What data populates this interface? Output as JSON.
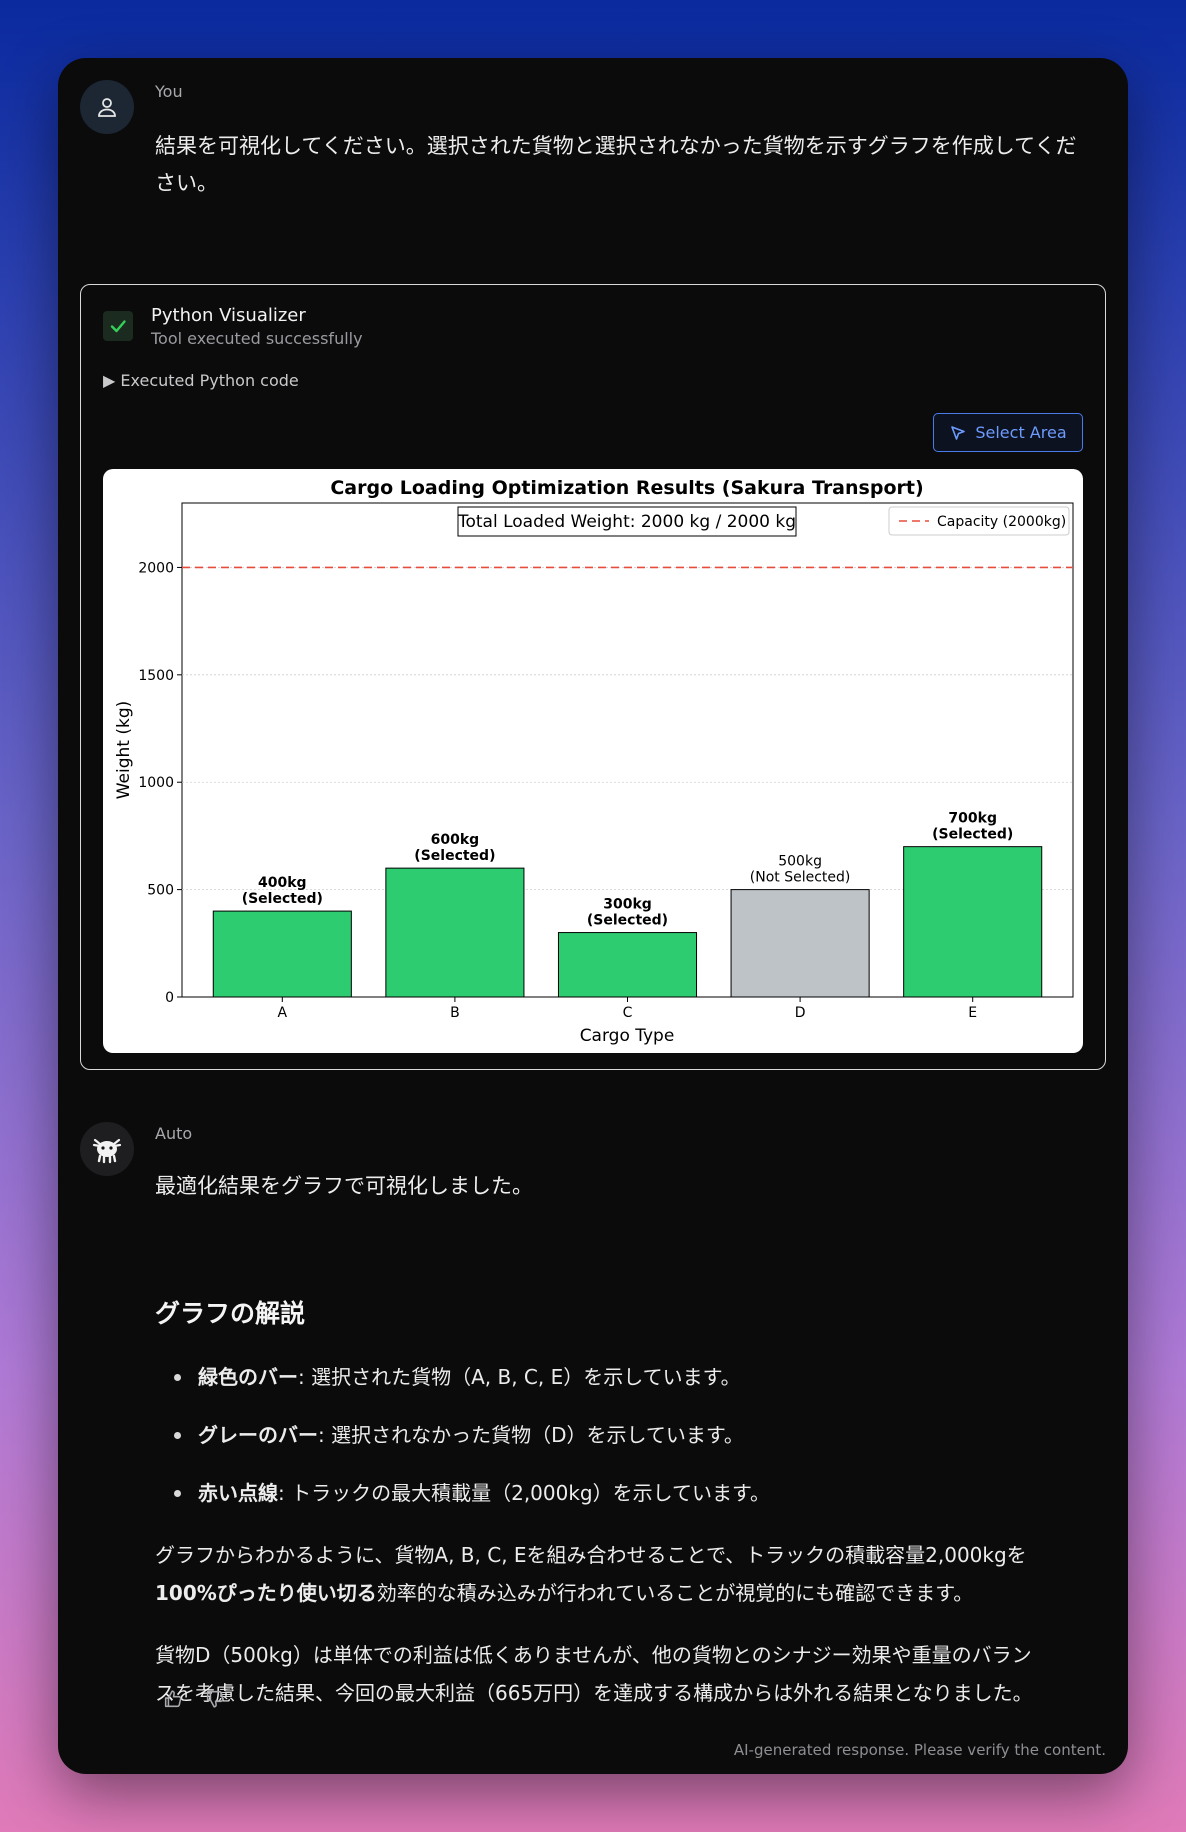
{
  "user_message": {
    "author": "You",
    "line1": "結果を可視化してください。選択された貨物と選択されなかった貨物を示すグラフを作成してくだ",
    "line2": "さい。"
  },
  "tool": {
    "title": "Python Visualizer",
    "status": "Tool executed successfully",
    "code_toggle": "▶ Executed Python code",
    "select_area": "Select Area"
  },
  "chart_data": {
    "type": "bar",
    "title": "Cargo Loading Optimization Results (Sakura Transport)",
    "annotation": "Total Loaded Weight: 2000 kg / 2000 kg",
    "xlabel": "Cargo Type",
    "ylabel": "Weight (kg)",
    "categories": [
      "A",
      "B",
      "C",
      "D",
      "E"
    ],
    "values": [
      400,
      600,
      300,
      500,
      700
    ],
    "selected": [
      true,
      true,
      true,
      false,
      true
    ],
    "labels": [
      [
        "400kg",
        "(Selected)"
      ],
      [
        "600kg",
        "(Selected)"
      ],
      [
        "300kg",
        "(Selected)"
      ],
      [
        "500kg",
        "(Not Selected)"
      ],
      [
        "700kg",
        "(Selected)"
      ]
    ],
    "yticks": [
      0,
      500,
      1000,
      1500,
      2000
    ],
    "ylim": [
      0,
      2300
    ],
    "capacity": 2000,
    "legend": "Capacity (2000kg)",
    "legend_position": "top-right",
    "grid": true,
    "colors": {
      "selected": "#2ecc71",
      "not_selected": "#bdc3c7",
      "capacity": "#e74c3c"
    }
  },
  "bot_message": {
    "author": "Auto",
    "intro": "最適化結果をグラフで可視化しました。",
    "heading": "グラフの解説",
    "bullets": [
      {
        "term": "緑色のバー",
        "text": ": 選択された貨物（A, B, C, E）を示しています。"
      },
      {
        "term": "グレーのバー",
        "text": ": 選択されなかった貨物（D）を示しています。"
      },
      {
        "term": "赤い点線",
        "text": ": トラックの最大積載量（2,000kg）を示しています。"
      }
    ],
    "para1_a": "グラフからわかるように、貨物A, B, C, Eを組み合わせることで、トラックの積載容量2,000kgを",
    "para1_bold": "100%ぴったり使い切る",
    "para1_b": "効率的な積み込みが行われていることが視覚的にも確認できます。",
    "para2_line1": "貨物D（500kg）は単体での利益は低くありませんが、他の貨物とのシナジー効果や重量のバラン",
    "para2_line2": "スを考慮した結果、今回の最大利益（665万円）を達成する構成からは外れる結果となりました。"
  },
  "footer": {
    "disclaimer": "AI-generated response. Please verify the content."
  }
}
